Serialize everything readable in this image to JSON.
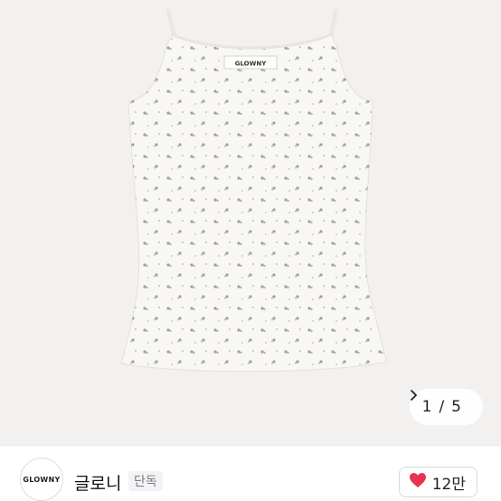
{
  "product": {
    "shirt_label": "GLOWNY",
    "image_counter": {
      "current": "1",
      "separator": "/",
      "total": "5"
    }
  },
  "brand": {
    "logo_text": "GLOWNY",
    "name": "글로니",
    "badge": "단독",
    "likes": "12만"
  },
  "colors": {
    "heart": "#e8344e",
    "fabric": "#f7f6f3",
    "background": "#f2f1ef"
  },
  "icons": {
    "next": "chevron-right-icon",
    "like": "heart-icon"
  }
}
